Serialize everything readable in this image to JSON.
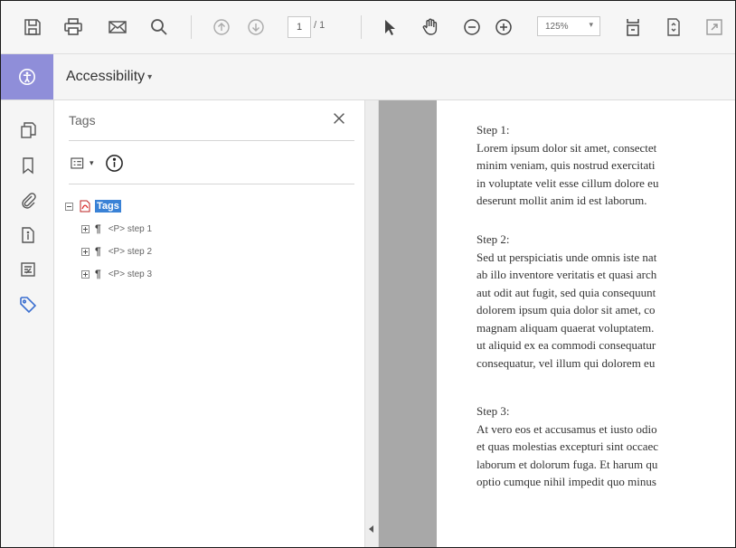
{
  "toolbar": {
    "page_current": "1",
    "page_total": "/ 1",
    "zoom": "125%"
  },
  "accessibility_bar": {
    "title": "Accessibility"
  },
  "tags_panel": {
    "title": "Tags",
    "tree": {
      "root_label": "Tags",
      "children": [
        {
          "label": "<P> step 1"
        },
        {
          "label": "<P> step 2"
        },
        {
          "label": "<P> step 3"
        }
      ]
    }
  },
  "document": {
    "sections": [
      {
        "heading": "Step 1:",
        "lines": [
          "Lorem ipsum dolor sit amet, consectet",
          "minim veniam, quis nostrud exercitati",
          "in voluptate velit esse cillum dolore eu",
          "deserunt mollit anim id est laborum."
        ]
      },
      {
        "heading": "Step 2:",
        "lines": [
          "Sed ut perspiciatis unde omnis iste nat",
          "ab illo inventore veritatis et quasi arch",
          "aut odit aut fugit, sed quia consequunt",
          "dolorem ipsum quia dolor sit amet, co",
          "magnam aliquam quaerat voluptatem.",
          "ut aliquid ex ea commodi consequatur",
          "consequatur, vel illum qui dolorem eu"
        ]
      },
      {
        "heading": "Step 3:",
        "lines": [
          "At vero eos et accusamus et iusto odio",
          "et quas molestias excepturi sint occaec",
          "laborum et dolorum fuga. Et harum qu",
          "optio cumque nihil impedit quo minus"
        ]
      }
    ]
  },
  "icons": {
    "toolbar": [
      "save-icon",
      "print-icon",
      "email-icon",
      "search-icon",
      "page-up-icon",
      "page-down-icon",
      "select-cursor-icon",
      "hand-tool-icon",
      "zoom-out-icon",
      "zoom-in-icon",
      "fit-page-icon",
      "scroll-mode-icon",
      "full-screen-icon"
    ],
    "left_nav": [
      "page-thumbnails-icon",
      "bookmarks-icon",
      "attachments-icon",
      "document-properties-icon",
      "content-icon",
      "tags-icon"
    ]
  },
  "colors": {
    "accessibility_accent": "#8f8ed9",
    "tag_highlight": "#3a82d6",
    "active_nav_icon": "#3b6fd0"
  }
}
